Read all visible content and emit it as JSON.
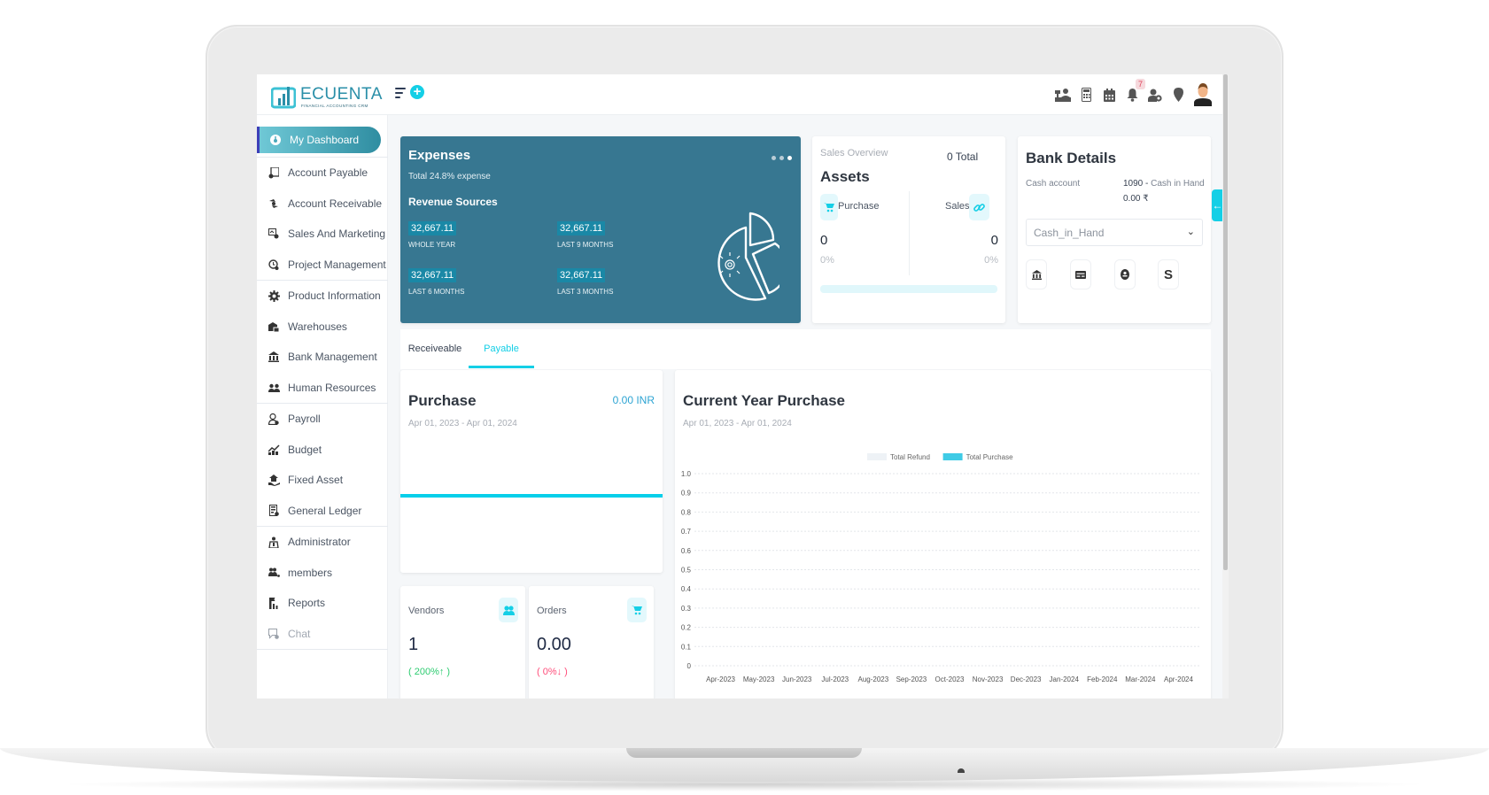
{
  "brand": {
    "name": "ECUENTA",
    "tagline": "FINANCIAL ACCOUNTING CRM"
  },
  "topbar": {
    "icons": [
      "cashier-icon",
      "calculator-icon",
      "calendar-icon",
      "bell-icon",
      "user-clock-icon",
      "map-pin-icon",
      "user-avatar-icon"
    ],
    "notification_count": "7"
  },
  "sidebar": {
    "items": [
      {
        "label": "My Dashboard",
        "icon": "dashboard-icon",
        "active": true
      },
      {
        "label": "Account Payable",
        "icon": "payable-icon"
      },
      {
        "label": "Account Receivable",
        "icon": "receivable-icon"
      },
      {
        "label": "Sales And Marketing",
        "icon": "sales-icon"
      },
      {
        "label": "Project Management",
        "icon": "project-icon"
      },
      {
        "label": "Product Information",
        "icon": "gear-icon"
      },
      {
        "label": "Warehouses",
        "icon": "warehouse-icon"
      },
      {
        "label": "Bank Management",
        "icon": "bank-icon"
      },
      {
        "label": "Human Resources",
        "icon": "people-icon"
      },
      {
        "label": "Payroll",
        "icon": "payroll-icon"
      },
      {
        "label": "Budget",
        "icon": "budget-icon"
      },
      {
        "label": "Fixed Asset",
        "icon": "fixed-asset-icon"
      },
      {
        "label": "General Ledger",
        "icon": "ledger-icon"
      },
      {
        "label": "Administrator",
        "icon": "admin-icon"
      },
      {
        "label": "members",
        "icon": "members-icon"
      },
      {
        "label": "Reports",
        "icon": "reports-icon"
      },
      {
        "label": "Chat",
        "icon": "chat-icon",
        "muted": true
      }
    ]
  },
  "expenses": {
    "title": "Expenses",
    "subtitle": "Total 24.8% expense",
    "revenue_title": "Revenue Sources",
    "stats": [
      {
        "value": "32,667.11",
        "label": "WHOLE YEAR"
      },
      {
        "value": "32,667.11",
        "label": "LAST 9 MONTHS"
      },
      {
        "value": "32,667.11",
        "label": "LAST 6 MONTHS"
      },
      {
        "value": "32,667.11",
        "label": "LAST 3 MONTHS"
      }
    ]
  },
  "assets": {
    "overline": "Sales Overview",
    "total": "0 Total",
    "title": "Assets",
    "purchase_label": "Purchase",
    "sales_label": "Sales",
    "purchase_value": "0",
    "sales_value": "0",
    "purchase_pct": "0%",
    "sales_pct": "0%",
    "progress": 0
  },
  "bank": {
    "title": "Bank Details",
    "cash_label": "Cash account",
    "account_number": "1090",
    "account_sep": " - ",
    "account_name": "Cash in Hand",
    "amount": "0.00 ₹",
    "select_value": "Cash_in_Hand",
    "chevron": "⌄",
    "buttons": [
      "bank-icon",
      "card-icon",
      "wallet-icon",
      "dollar-icon"
    ]
  },
  "tabs": [
    {
      "label": "Receiveable",
      "active": false
    },
    {
      "label": "Payable",
      "active": true
    }
  ],
  "purchase": {
    "title": "Purchase",
    "amount": "0.00 INR",
    "date_range": "Apr 01, 2023 - Apr 01, 2024"
  },
  "vendors": {
    "label": "Vendors",
    "value": "1",
    "change": "( 200%↑ )"
  },
  "orders": {
    "label": "Orders",
    "value": "0.00",
    "change": "( 0%↓ )"
  },
  "chart": {
    "title": "Current Year Purchase",
    "date_range": "Apr 01, 2023 - Apr 01, 2024"
  },
  "chart_data": {
    "type": "bar",
    "title": "Current Year Purchase",
    "xlabel": "",
    "ylabel": "",
    "categories": [
      "Apr-2023",
      "May-2023",
      "Jun-2023",
      "Jul-2023",
      "Aug-2023",
      "Sep-2023",
      "Oct-2023",
      "Nov-2023",
      "Dec-2023",
      "Jan-2024",
      "Feb-2024",
      "Mar-2024",
      "Apr-2024"
    ],
    "series": [
      {
        "name": "Total Refund",
        "color": "#eef2f6",
        "values": [
          0,
          0,
          0,
          0,
          0,
          0,
          0,
          0,
          0,
          0,
          0,
          0,
          0
        ]
      },
      {
        "name": "Total Purchase",
        "color": "#3fcbe6",
        "values": [
          0,
          0,
          0,
          0,
          0,
          0,
          0,
          0,
          0,
          0,
          0,
          0,
          0
        ]
      }
    ],
    "yticks": [
      "0",
      "0.1",
      "0.2",
      "0.3",
      "0.4",
      "0.5",
      "0.6",
      "0.7",
      "0.8",
      "0.9",
      "1.0"
    ],
    "ylim": [
      0,
      1.0
    ],
    "grid": true,
    "legend": "top-center"
  }
}
